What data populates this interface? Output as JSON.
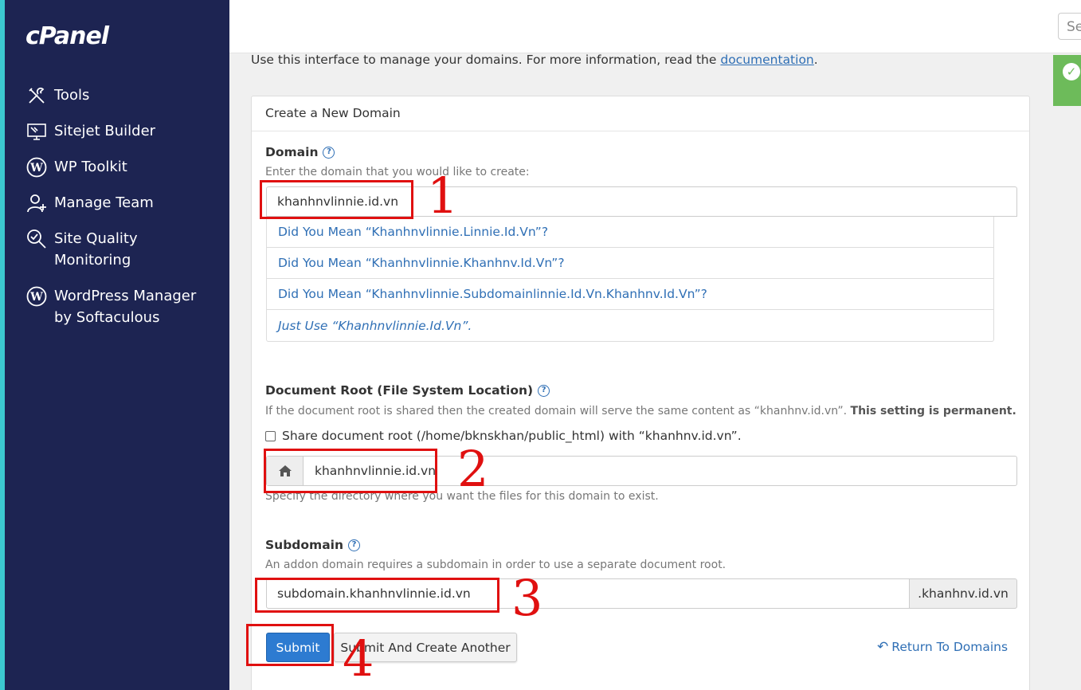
{
  "brand": {
    "logo": "cPanel"
  },
  "sidebar": {
    "items": [
      {
        "label": "Tools",
        "icon": "tools-icon"
      },
      {
        "label": "Sitejet Builder",
        "icon": "sitejet-icon"
      },
      {
        "label": "WP Toolkit",
        "icon": "wordpress-icon"
      },
      {
        "label": "Manage Team",
        "icon": "manage-team-icon"
      },
      {
        "label": "Site Quality Monitoring",
        "icon": "search-quality-icon"
      },
      {
        "label": "WordPress Manager by Softaculous",
        "icon": "wordpress-icon"
      }
    ]
  },
  "topbar": {
    "search_placeholder": "Se"
  },
  "intro": {
    "text": "Use this interface to manage your domains. For more information, read the ",
    "link": "documentation",
    "end": "."
  },
  "panel": {
    "heading": "Create a New Domain",
    "domain": {
      "label": "Domain",
      "hint": "Enter the domain that you would like to create:",
      "value": "khanhnvlinnie.id.vn",
      "suggestions": [
        "Did You Mean “Khanhnvlinnie.Linnie.Id.Vn”?",
        "Did You Mean “Khanhnvlinnie.Khanhnv.Id.Vn”?",
        "Did You Mean “Khanhnvlinnie.Subdomainlinnie.Id.Vn.Khanhnv.Id.Vn”?",
        "Just Use “Khanhnvlinnie.Id.Vn”."
      ]
    },
    "docroot": {
      "label": "Document Root (File System Location)",
      "hint": "If the document root is shared then the created domain will serve the same content as “khanhnv.id.vn”.",
      "hint_bold": "This setting is permanent.",
      "share_label": "Share document root (/home/bknskhan/public_html) with “khanhnv.id.vn”.",
      "share_checked": false,
      "value": "khanhnvlinnie.id.vn",
      "hint2": "Specify the directory where you want the files for this domain to exist."
    },
    "subdomain": {
      "label": "Subdomain",
      "hint": "An addon domain requires a subdomain in order to use a separate document root.",
      "value": "subdomain.khanhnvlinnie.id.vn",
      "suffix": ".khanhnv.id.vn"
    },
    "buttons": {
      "submit": "Submit",
      "submit_another": "Submit And Create Another",
      "return": "Return To Domains"
    }
  },
  "annotations": [
    "1",
    "2",
    "3",
    "4"
  ],
  "colors": {
    "sidebar": "#1d2452",
    "accent": "#2d7bd1",
    "link": "#2f6fb5",
    "annotation": "#e01010",
    "success": "#6dbb5a"
  }
}
